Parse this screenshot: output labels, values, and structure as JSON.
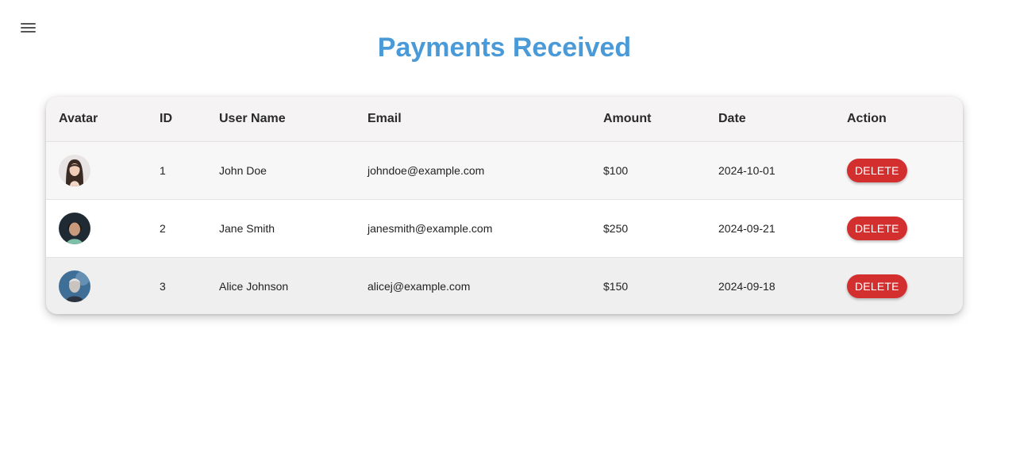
{
  "header": {
    "title": "Payments Received",
    "menu_icon": "hamburger-menu-icon"
  },
  "table": {
    "columns": [
      "Avatar",
      "ID",
      "User Name",
      "Email",
      "Amount",
      "Date",
      "Action"
    ],
    "rows": [
      {
        "avatar": "avatar-woman-dark-hair",
        "id": "1",
        "name": "John Doe",
        "email": "johndoe@example.com",
        "amount": "$100",
        "date": "2024-10-01",
        "action": "DELETE"
      },
      {
        "avatar": "avatar-child-dark-background",
        "id": "2",
        "name": "Jane Smith",
        "email": "janesmith@example.com",
        "amount": "$250",
        "date": "2024-09-21",
        "action": "DELETE"
      },
      {
        "avatar": "avatar-man-blue-background",
        "id": "3",
        "name": "Alice Johnson",
        "email": "alicej@example.com",
        "amount": "$150",
        "date": "2024-09-18",
        "action": "DELETE"
      }
    ]
  },
  "colors": {
    "title": "#4a9ad8",
    "delete_button": "#d32f2f"
  }
}
